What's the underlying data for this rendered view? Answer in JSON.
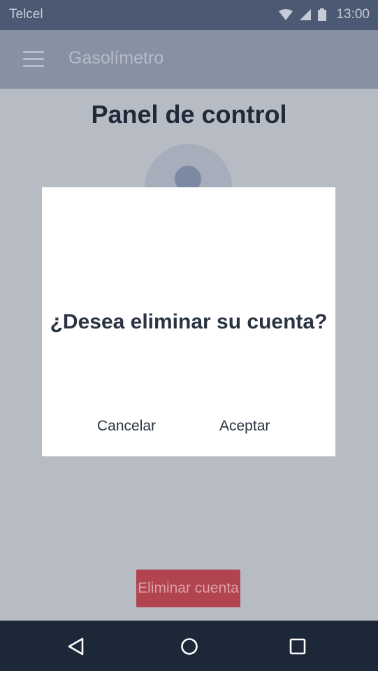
{
  "status_bar": {
    "carrier": "Telcel",
    "time": "13:00",
    "icons": [
      "wifi-icon",
      "signal-icon",
      "battery-icon"
    ]
  },
  "app_bar": {
    "title": "Gasolímetro",
    "menu_icon": "hamburger-menu-icon"
  },
  "page": {
    "title": "Panel de control",
    "avatar_icon": "user-avatar-icon",
    "delete_button_label": "Eliminar cuenta"
  },
  "dialog": {
    "message": "¿Desea eliminar su cuenta?",
    "cancel_label": "Cancelar",
    "accept_label": "Aceptar"
  },
  "nav_bar": {
    "icons": [
      "back-icon",
      "home-icon",
      "recents-icon"
    ]
  },
  "colors": {
    "status_bar": "#4b5a72",
    "app_bar": "#8791a3",
    "scrim_background": "#b6bbc4",
    "danger_button": "#b2444f",
    "nav_bar": "#1c2738",
    "dialog": "#ffffff",
    "text_dark": "#1f2938"
  }
}
